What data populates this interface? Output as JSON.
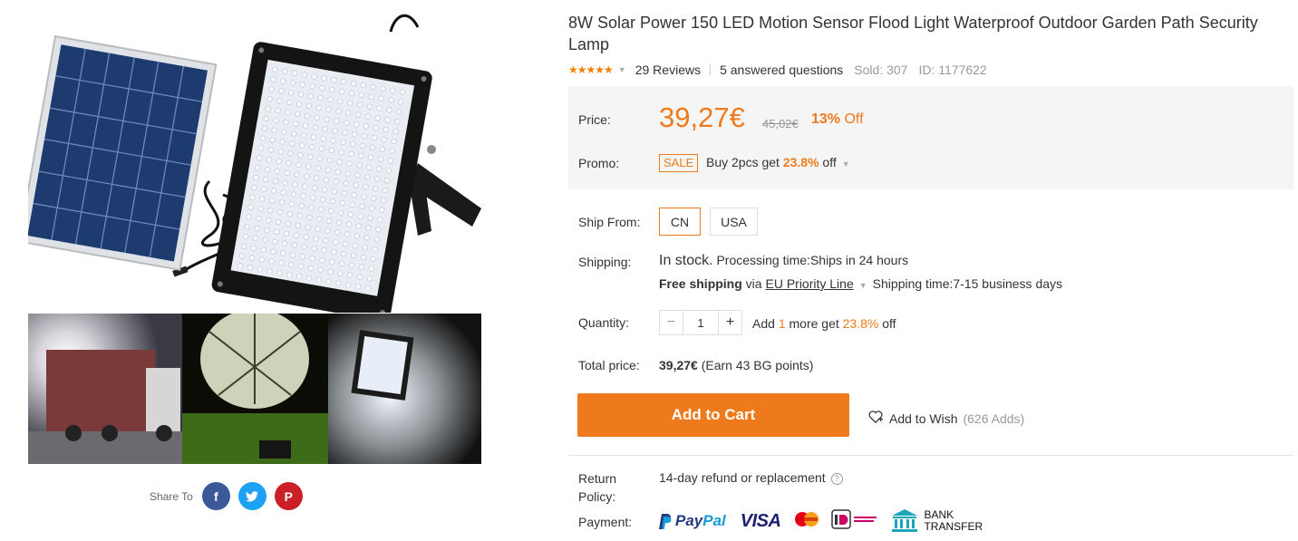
{
  "product": {
    "title": "8W Solar Power 150 LED Motion Sensor Flood Light Waterproof Outdoor Garden Path Security Lamp",
    "rating_stars": "★★★★★",
    "reviews": "29 Reviews",
    "answered": "5 answered questions",
    "sold": "Sold: 307",
    "id": "ID: 1177622"
  },
  "price": {
    "label": "Price:",
    "current": "39,27€",
    "original": "45,02€",
    "discount_num": "13%",
    "discount_off": "Off"
  },
  "promo": {
    "label": "Promo:",
    "tag": "SALE",
    "text_prefix": "Buy 2pcs get ",
    "percent": "23.8%",
    "text_suffix": " off"
  },
  "ship_from": {
    "label": "Ship From:",
    "options": [
      "CN",
      "USA"
    ],
    "selected": "CN"
  },
  "shipping": {
    "label": "Shipping:",
    "stock": "In stock.",
    "processing": " Processing time:Ships in 24 hours",
    "free": "Free shipping",
    "via": " via ",
    "method": "EU Priority Line",
    "time": "Shipping time:7-15 business days"
  },
  "quantity": {
    "label": "Quantity:",
    "minus": "−",
    "value": "1",
    "plus": "+",
    "offer_prefix": "Add ",
    "offer_num": "1",
    "offer_mid": " more get ",
    "offer_percent": "23.8%",
    "offer_suffix": " off"
  },
  "total": {
    "label": "Total price:",
    "value": "39,27€",
    "points": " (Earn 43 BG points)"
  },
  "actions": {
    "cart": "Add to Cart",
    "wish": "Add to Wish",
    "wish_count": "(626 Adds)"
  },
  "policy": {
    "label_line1": "Return",
    "label_line2": "Policy:",
    "text": "14-day refund or replacement",
    "help": "?"
  },
  "payment": {
    "label": "Payment:",
    "paypal_a": "Pay",
    "paypal_b": "Pal",
    "visa": "VISA",
    "bank_line1": "BANK",
    "bank_line2": "TRANSFER"
  },
  "share": {
    "label": "Share To",
    "facebook": "f",
    "pinterest": "P"
  },
  "colors": {
    "accent": "#ee7a1b",
    "facebook": "#3b5998",
    "twitter": "#1da1f2",
    "pinterest": "#cb2027"
  },
  "icons": [
    "stars-rating",
    "caret-down-icon",
    "heart-plus-icon",
    "help-icon",
    "facebook-icon",
    "twitter-icon",
    "pinterest-icon",
    "paypal-logo",
    "visa-logo",
    "mastercard-logo",
    "ideal-logo",
    "bank-icon"
  ]
}
